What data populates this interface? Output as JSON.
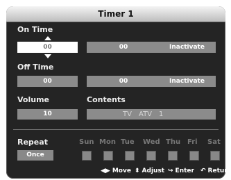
{
  "title": "Timer 1",
  "on_time": {
    "label": "On Time",
    "hour": "00",
    "minute": "00",
    "state": "Inactivate"
  },
  "off_time": {
    "label": "Off Time",
    "hour": "00",
    "minute": "00",
    "state": "Inactivate"
  },
  "volume": {
    "label": "Volume",
    "value": "10"
  },
  "contents": {
    "label": "Contents",
    "source": "TV",
    "antenna": "ATV",
    "channel": "1"
  },
  "repeat": {
    "label": "Repeat",
    "value": "Once"
  },
  "days": [
    {
      "label": "Sun",
      "checked": false
    },
    {
      "label": "Mon",
      "checked": false
    },
    {
      "label": "Tue",
      "checked": false
    },
    {
      "label": "Wed",
      "checked": false
    },
    {
      "label": "Thu",
      "checked": false
    },
    {
      "label": "Fri",
      "checked": false
    },
    {
      "label": "Sat",
      "checked": false
    }
  ],
  "footer": {
    "move": "Move",
    "adjust": "Adjust",
    "enter": "Enter",
    "return": "Return"
  },
  "icons": {
    "move": "left-right-arrows-icon",
    "adjust": "up-down-arrows-icon",
    "enter": "enter-icon",
    "return": "return-icon"
  }
}
